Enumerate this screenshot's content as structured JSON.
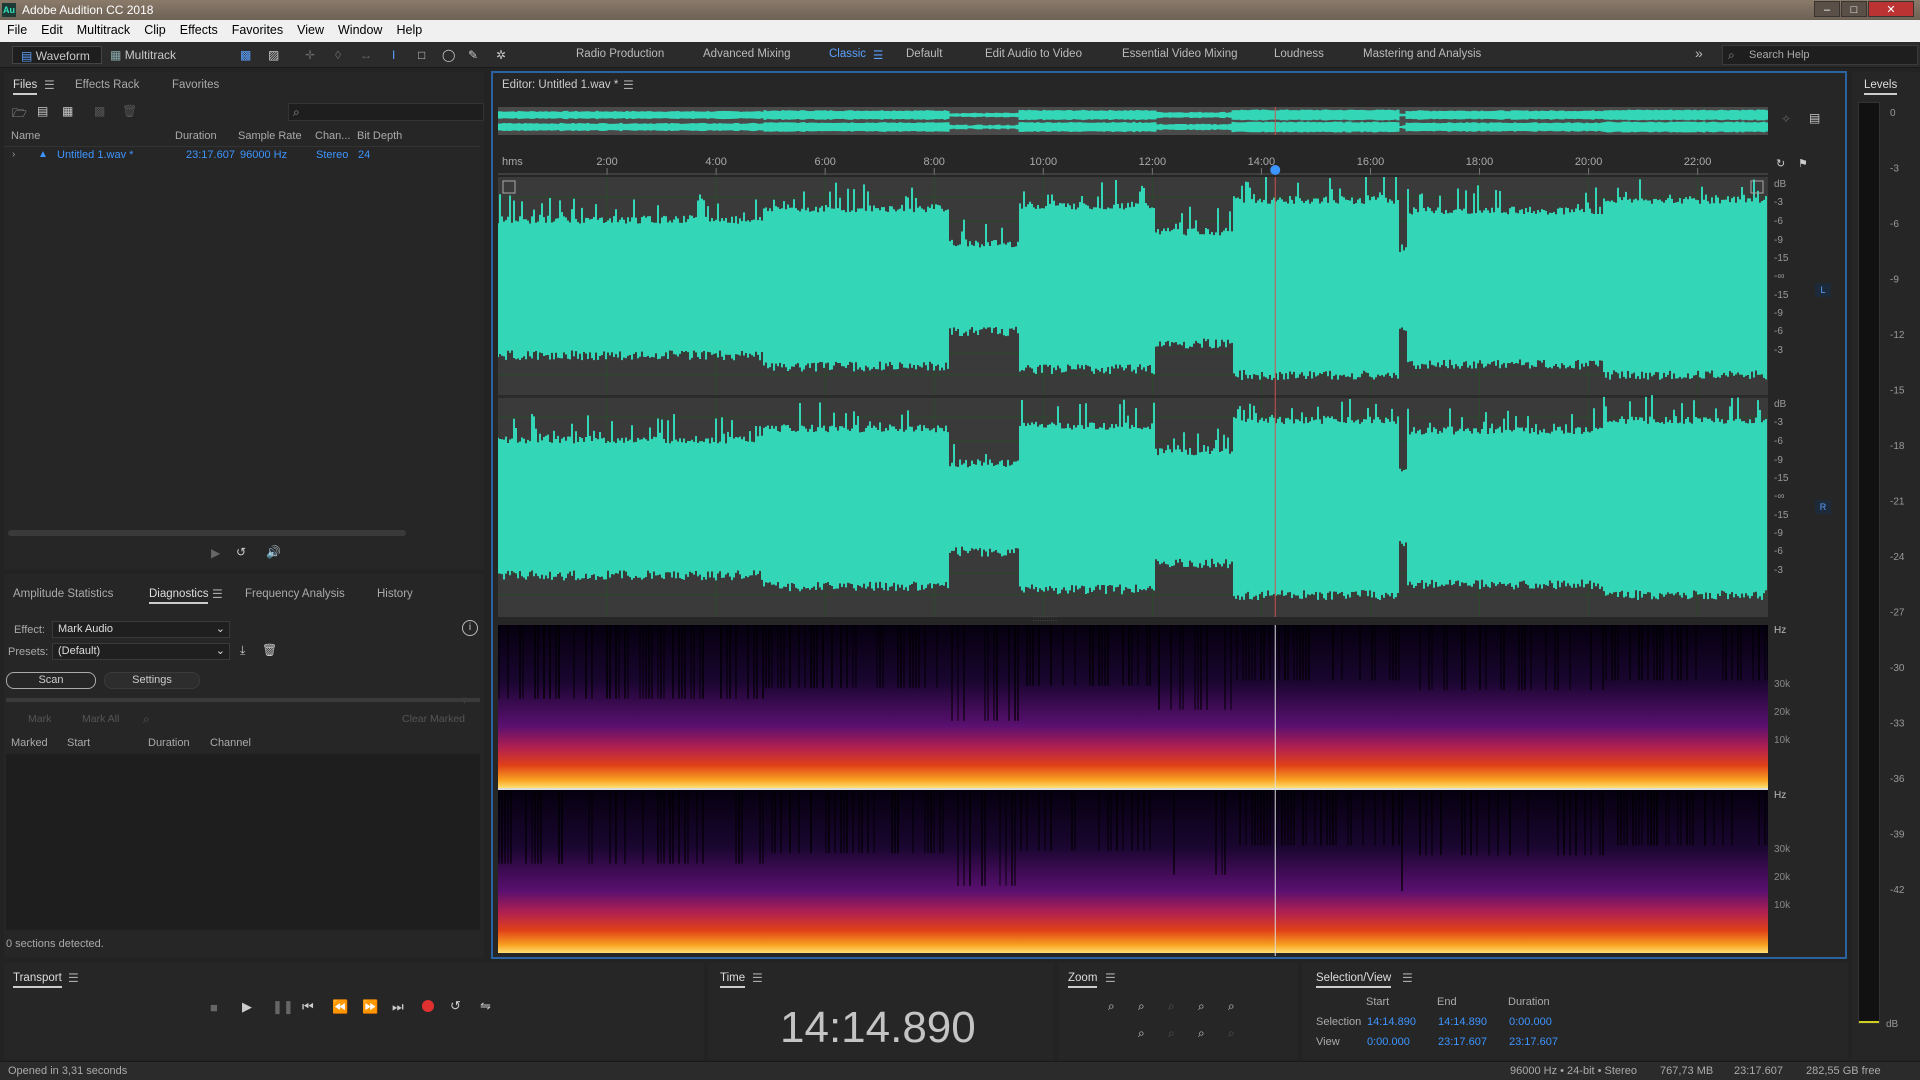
{
  "app": {
    "title": "Adobe Audition CC 2018",
    "logo": "Au"
  },
  "menu": [
    "File",
    "Edit",
    "Multitrack",
    "Clip",
    "Effects",
    "Favorites",
    "View",
    "Window",
    "Help"
  ],
  "toolbar": {
    "waveform": "Waveform",
    "multitrack": "Multitrack",
    "search_placeholder": "Search Help"
  },
  "workspaces": [
    {
      "label": "Radio Production",
      "active": false
    },
    {
      "label": "Advanced Mixing",
      "active": false
    },
    {
      "label": "Classic",
      "active": true
    },
    {
      "label": "Default",
      "active": false
    },
    {
      "label": "Edit Audio to Video",
      "active": false
    },
    {
      "label": "Essential Video Mixing",
      "active": false
    },
    {
      "label": "Loudness",
      "active": false
    },
    {
      "label": "Mastering and Analysis",
      "active": false
    }
  ],
  "files_panel": {
    "tabs": [
      "Files",
      "Effects Rack",
      "Favorites"
    ],
    "columns": [
      "Name",
      "Duration",
      "Sample Rate",
      "Chan...",
      "Bit Depth"
    ],
    "rows": [
      {
        "name": "Untitled 1.wav *",
        "duration": "23:17.607",
        "sample_rate": "96000 Hz",
        "channels": "Stereo",
        "bit_depth": "24"
      }
    ]
  },
  "diag_panel": {
    "tabs": [
      "Amplitude Statistics",
      "Diagnostics",
      "Frequency Analysis",
      "History"
    ],
    "effect_label": "Effect:",
    "effect_value": "Mark Audio",
    "presets_label": "Presets:",
    "presets_value": "(Default)",
    "scan": "Scan",
    "settings": "Settings",
    "mark": "Mark",
    "mark_all": "Mark All",
    "clear_marked": "Clear Marked",
    "columns": [
      "Marked",
      "Start",
      "Duration",
      "Channel"
    ],
    "status": "0 sections detected."
  },
  "editor": {
    "title": "Editor: Untitled 1.wav *",
    "ruler": [
      "hms",
      "2:00",
      "4:00",
      "6:00",
      "8:00",
      "10:00",
      "12:00",
      "14:00",
      "16:00",
      "18:00",
      "20:00",
      "22:00"
    ],
    "db_labels": [
      "dB",
      "-3",
      "-6",
      "-9",
      "-15",
      "-∞",
      "-15",
      "-9",
      "-6",
      "-3"
    ],
    "channel_left": "L",
    "channel_right": "R",
    "hz_labels": [
      "Hz",
      "30k",
      "20k",
      "10k"
    ],
    "playhead_fraction": 0.612,
    "colors": {
      "waveform": "#33d7b8",
      "playhead": "#d05050"
    }
  },
  "levels": {
    "title": "Levels",
    "scale": [
      "0",
      "-3",
      "-6",
      "-9",
      "-12",
      "-15",
      "-18",
      "-21",
      "-24",
      "-27",
      "-30",
      "-33",
      "-36",
      "-39",
      "-42",
      "dB"
    ]
  },
  "transport": {
    "title": "Transport"
  },
  "time": {
    "title": "Time",
    "value": "14:14.890"
  },
  "zoom": {
    "title": "Zoom"
  },
  "selection_view": {
    "title": "Selection/View",
    "headers": [
      "Start",
      "End",
      "Duration"
    ],
    "selection_label": "Selection",
    "selection": [
      "14:14.890",
      "14:14.890",
      "0:00.000"
    ],
    "view_label": "View",
    "view": [
      "0:00.000",
      "23:17.607",
      "23:17.607"
    ]
  },
  "status_bar": {
    "left": "Opened in 3,31 seconds",
    "format": "96000 Hz • 24-bit • Stereo",
    "size": "767,73 MB",
    "duration": "23:17.607",
    "free": "282,55 GB free"
  }
}
